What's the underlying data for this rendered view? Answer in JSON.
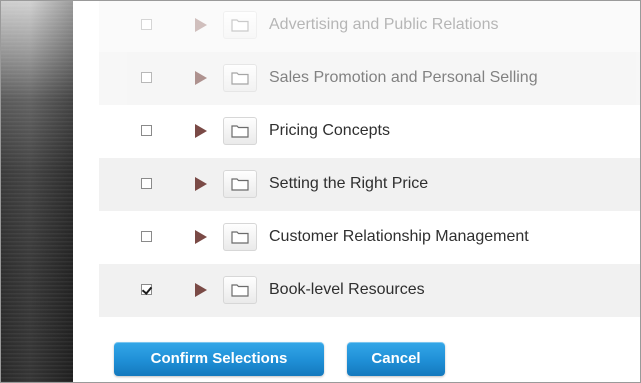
{
  "items": [
    {
      "label": "Advertising and Public Relations",
      "checked": false
    },
    {
      "label": "Sales Promotion and Personal Selling",
      "checked": false
    },
    {
      "label": "Pricing Concepts",
      "checked": false
    },
    {
      "label": "Setting the Right Price",
      "checked": false
    },
    {
      "label": "Customer Relationship Management",
      "checked": false
    },
    {
      "label": "Book-level Resources",
      "checked": true
    }
  ],
  "actions": {
    "confirm_label": "Confirm Selections",
    "cancel_label": "Cancel"
  },
  "colors": {
    "primary": "#1f8fd6",
    "expand_arrow": "#7a4a46",
    "row_alt": "#f1f1f1"
  },
  "icons": {
    "checkbox": "checkbox",
    "expand": "triangle-right-icon",
    "folder": "folder-icon"
  }
}
